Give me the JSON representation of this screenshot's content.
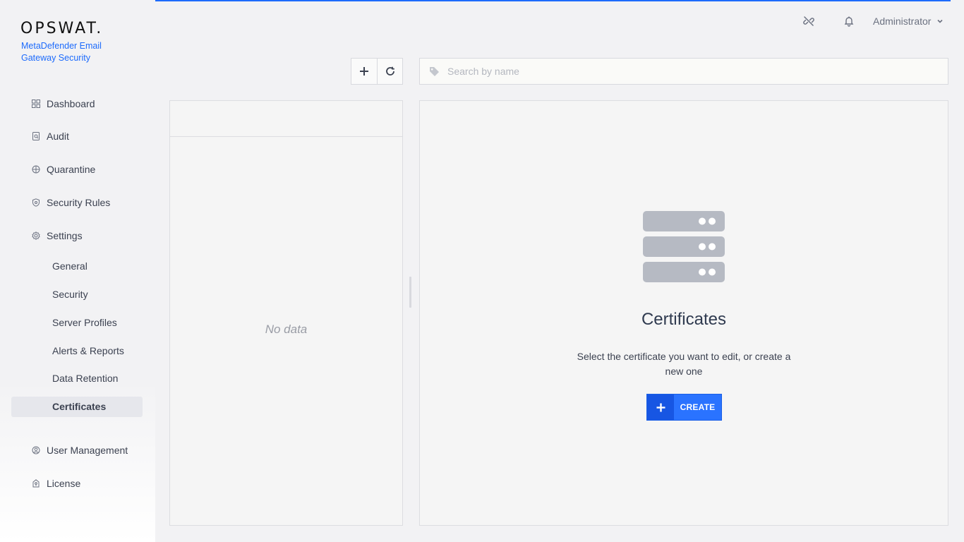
{
  "brand": {
    "logo_text": "OPSWAT.",
    "product_name": "MetaDefender Email Gateway Security",
    "accent_color": "#1d6bfc"
  },
  "header": {
    "user_name": "Administrator",
    "icons": [
      "unlink-icon",
      "bell-icon",
      "chevron-down-icon"
    ]
  },
  "sidebar": {
    "items": [
      {
        "label": "Dashboard",
        "icon": "dashboard-icon"
      },
      {
        "label": "Audit",
        "icon": "audit-icon"
      },
      {
        "label": "Quarantine",
        "icon": "quarantine-icon"
      },
      {
        "label": "Security Rules",
        "icon": "shield-icon"
      },
      {
        "label": "Settings",
        "icon": "gear-icon"
      }
    ],
    "settings_sub": [
      {
        "label": "General"
      },
      {
        "label": "Security"
      },
      {
        "label": "Server Profiles"
      },
      {
        "label": "Alerts & Reports"
      },
      {
        "label": "Data Retention"
      },
      {
        "label": "Certificates",
        "active": true
      }
    ],
    "bottom_items": [
      {
        "label": "User Management",
        "icon": "users-icon"
      },
      {
        "label": "License",
        "icon": "license-icon"
      }
    ]
  },
  "toolbar": {
    "add_icon": "plus-icon",
    "refresh_icon": "refresh-icon"
  },
  "search": {
    "placeholder": "Search by name",
    "value": ""
  },
  "list": {
    "empty_text": "No data"
  },
  "detail": {
    "title": "Certificates",
    "description": "Select the certificate you want to edit, or create a new one",
    "create_label": "CREATE",
    "illustration_color": "#b6bac3"
  }
}
